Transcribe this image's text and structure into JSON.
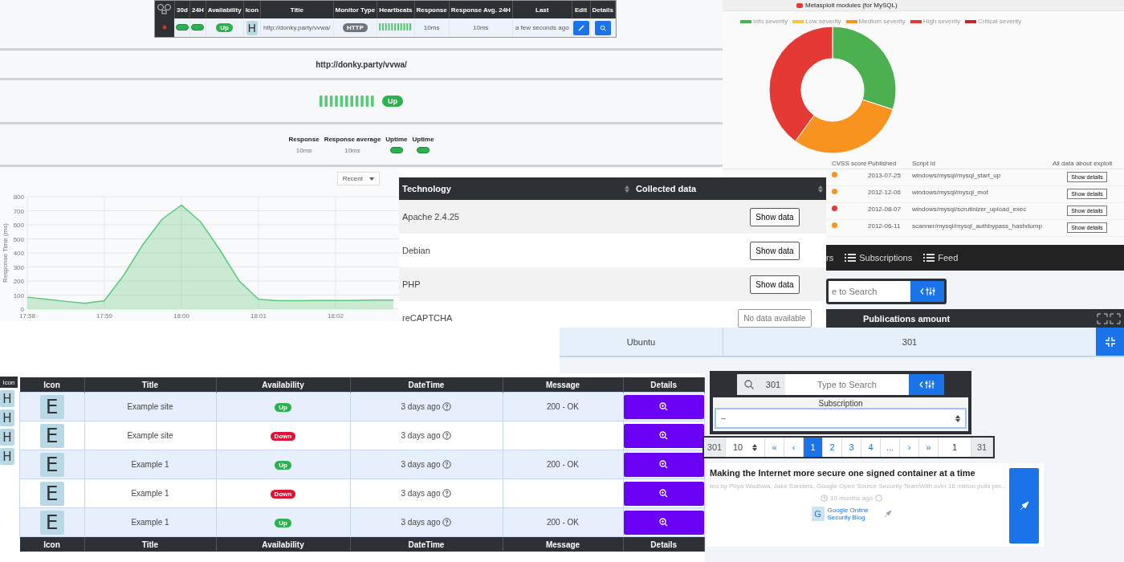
{
  "monitor_list": {
    "columns": [
      "30d",
      "24H",
      "Availability",
      "Icon",
      "Title",
      "Monitor Type",
      "Heartbeats",
      "Response",
      "Response Avg. 24H",
      "Last",
      "Edit",
      "Details"
    ],
    "row": {
      "icon_letter": "H",
      "url": "http://donky.party/vvwa/",
      "availability": "Up",
      "up": true,
      "monitor_type": "HTTP",
      "response": "10ms",
      "response_avg": "10ms",
      "last": "a few seconds ago"
    }
  },
  "monitor_detail": {
    "url": "http://donky.party/vvwa/",
    "status": "Up",
    "up": true,
    "stats": [
      {
        "label": "Response",
        "kind": "text",
        "value": "10ms"
      },
      {
        "label": "Response average",
        "kind": "text",
        "value": "10ms"
      },
      {
        "label": "Uptime",
        "kind": "pill"
      },
      {
        "label": "Uptime",
        "kind": "pill"
      }
    ]
  },
  "response_chart": {
    "range_select": "Recent",
    "chart_data": {
      "type": "area",
      "grid": true,
      "ylabel": "Response Time (ms)",
      "ylim": [
        0,
        800
      ],
      "yticks": [
        0,
        100,
        200,
        300,
        400,
        500,
        600,
        700,
        800
      ],
      "categories": [
        "17:58",
        null,
        null,
        null,
        "17:59",
        null,
        null,
        null,
        "18:00",
        null,
        null,
        null,
        "18:01",
        null,
        null,
        null,
        "18:02",
        null,
        null,
        null
      ],
      "series": [
        {
          "color": "#5cc87a",
          "values": [
            85,
            70,
            55,
            42,
            60,
            240,
            460,
            640,
            740,
            620,
            420,
            200,
            70,
            60,
            60,
            62,
            62,
            62,
            64,
            64
          ]
        }
      ]
    }
  },
  "metasploit": {
    "title": "Metasploit modules (for MySQL)",
    "legend": [
      {
        "color": "#4caf50"
      },
      {
        "color": "#f5c542"
      },
      {
        "color": "#f7931e"
      },
      {
        "color": "#e53935"
      },
      {
        "color": "#c62828"
      }
    ],
    "chart_data": {
      "type": "donut",
      "categories": [
        "Info severity",
        "Low severity",
        "Medium severity",
        "High severity",
        "Critical severity"
      ],
      "values": [
        30,
        0,
        30,
        40,
        0
      ]
    },
    "columns": [
      "CVSS score",
      "Published",
      "Script id",
      "All data about exploit"
    ],
    "rows": [
      {
        "color": "#f7931e",
        "published": "2013-07-25",
        "script_id": "windows/mysql/mysql_start_up",
        "action": "Show details"
      },
      {
        "color": "#f7931e",
        "published": "2012-12-06",
        "script_id": "windows/mysql/mysql_mof",
        "action": "Show details"
      },
      {
        "color": "#e53935",
        "published": "2012-08-07",
        "script_id": "windows/mysql/scrutinizer_upload_exec",
        "action": "Show details"
      },
      {
        "color": "#f7931e",
        "published": "2012-06-11",
        "script_id": "scanner/mysql/mysql_authbypass_hashdump",
        "action": "Show details"
      }
    ]
  },
  "technologies": {
    "columns": [
      "Technology",
      "Collected data"
    ],
    "rows": [
      {
        "name": "Apache 2.4.25",
        "action": "Show data",
        "available": true
      },
      {
        "name": "Debian",
        "action": "Show data",
        "available": true
      },
      {
        "name": "PHP",
        "action": "Show data",
        "available": true
      },
      {
        "name": "reCAPTCHA",
        "action": "No data available",
        "available": false
      }
    ]
  },
  "publications": {
    "nav": [
      "rs",
      "Subscriptions",
      "Feed"
    ],
    "search_placeholder": "e to Search",
    "columns": [
      "Publications amount"
    ],
    "row": [
      "Ubuntu",
      "301"
    ],
    "filter": {
      "count": "301",
      "search_placeholder": "Type to Search",
      "label": "Subscription",
      "select_value": "--"
    },
    "pagination": {
      "total": "301",
      "per_page": "10",
      "pages": [
        {
          "label": "«",
          "selected": false
        },
        {
          "label": "‹",
          "selected": false
        },
        {
          "label": "1",
          "selected": true
        },
        {
          "label": "2",
          "selected": false
        },
        {
          "label": "3",
          "selected": false
        },
        {
          "label": "4",
          "selected": false
        },
        {
          "label": "...",
          "selected": false
        },
        {
          "label": "›",
          "selected": false
        },
        {
          "label": "»",
          "selected": false
        }
      ],
      "goto": "1",
      "last": "31"
    },
    "article": {
      "title": "Making the Internet more secure one signed container at a time",
      "byline": "ted by Priya Wadhwa, Jake Sanders, Google Open Source Security TeamWith over 16 million pulls per...",
      "time": "10 months ago",
      "source_letter": "G",
      "source": "Google Online Security Blog"
    }
  },
  "sites": {
    "side_header": "Icon",
    "side_letters": [
      "H",
      "H",
      "H",
      "H"
    ],
    "columns": [
      "Icon",
      "Title",
      "Availability",
      "DateTime",
      "Message",
      "Details"
    ],
    "rows": [
      {
        "icon_letter": "E",
        "title": "Example site",
        "availability": "Up",
        "up": true,
        "datetime": "3 days ago",
        "message": "200 - OK"
      },
      {
        "icon_letter": "E",
        "title": "Example site",
        "availability": "Down",
        "up": false,
        "datetime": "3 days ago"
      },
      {
        "icon_letter": "E",
        "title": "Example 1",
        "availability": "Up",
        "up": true,
        "datetime": "3 days ago",
        "message": "200 - OK"
      },
      {
        "icon_letter": "E",
        "title": "Example 1",
        "availability": "Down",
        "up": false,
        "datetime": "3 days ago"
      },
      {
        "icon_letter": "E",
        "title": "Example 1",
        "availability": "Up",
        "up": true,
        "datetime": "3 days ago",
        "message": "200 - OK"
      }
    ],
    "footer": [
      "Icon",
      "Title",
      "Availability",
      "DateTime",
      "Message",
      "Details"
    ]
  }
}
